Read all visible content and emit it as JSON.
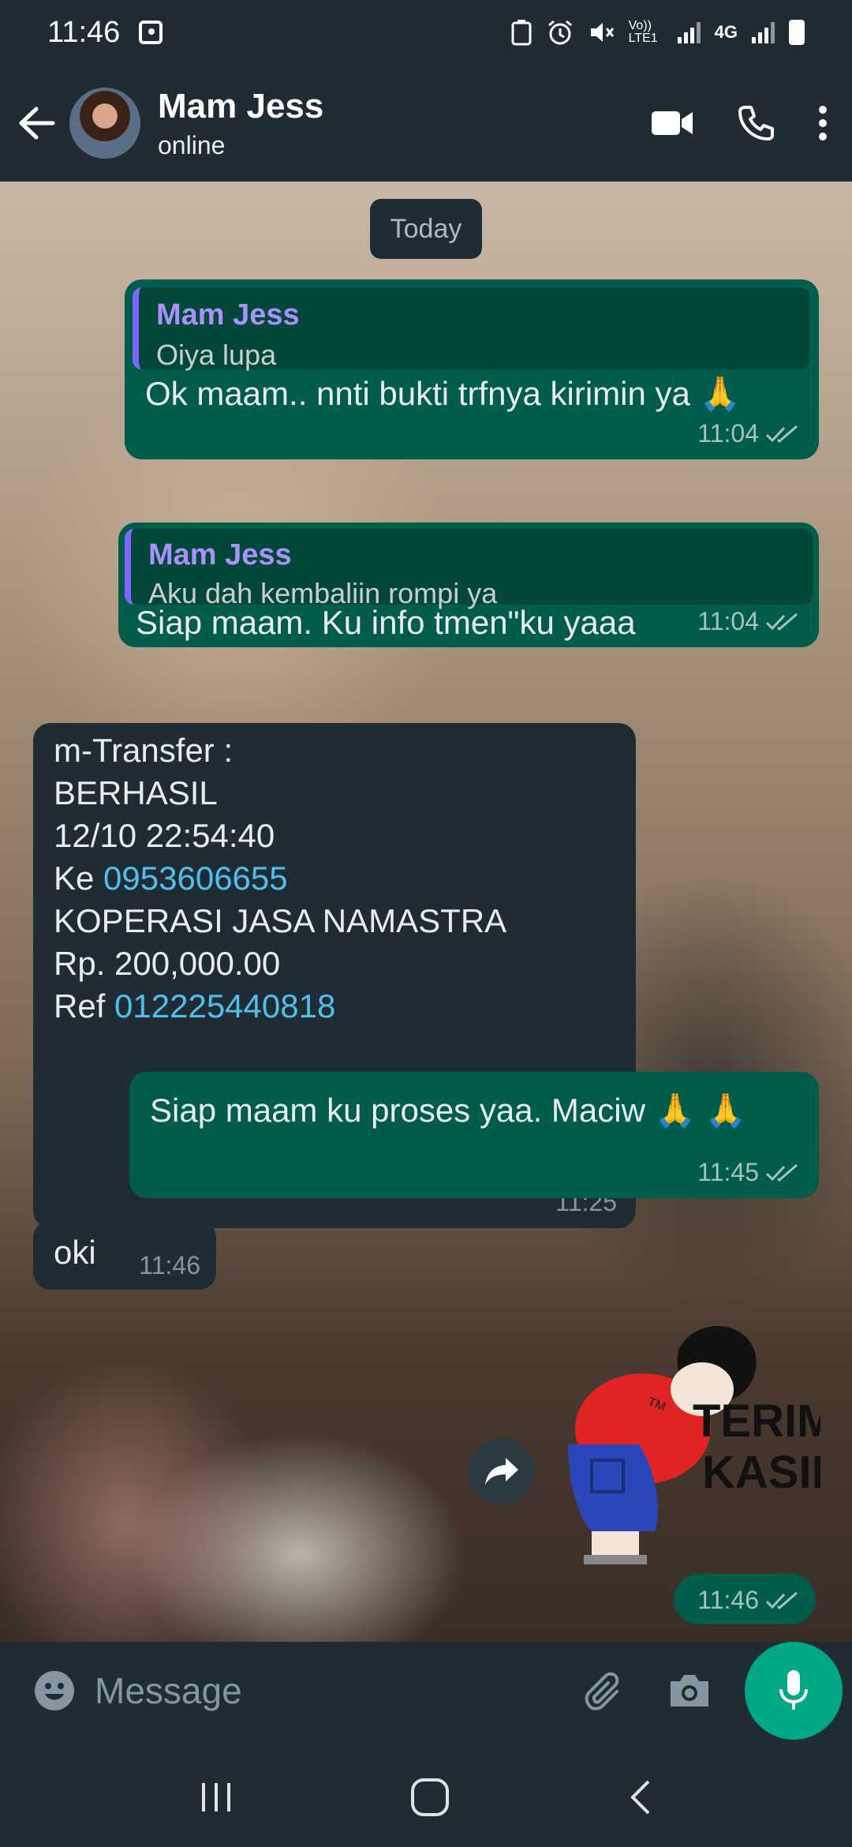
{
  "status_bar": {
    "time": "11:46",
    "network_1": "Vo)) LTE1",
    "network_2": "4G"
  },
  "header": {
    "contact_name": "Mam Jess",
    "contact_status": "online"
  },
  "chat": {
    "date_label": "Today",
    "messages": [
      {
        "quote_name": "Mam Jess",
        "quote_text": "Oiya lupa",
        "text": "Ok maam.. nnti bukti trfnya kirimin ya 🙏",
        "time": "11:04"
      },
      {
        "quote_name": "Mam Jess",
        "quote_text": "Aku dah kembaliin rompi ya",
        "text": "Siap maam. Ku info tmen\"ku yaaa",
        "time": "11:04"
      },
      {
        "lines": [
          "m-Transfer :",
          "BERHASIL",
          "12/10 22:54:40",
          "KOPERASI JASA NAMASTRA",
          "Rp. 200,000.00"
        ],
        "ke_label": "Ke",
        "ke_number": "0953606655",
        "ref_label": "Ref",
        "ref_number": "012225440818",
        "time": "11:25"
      },
      {
        "text": "Siap maam ku proses yaa. Maciw 🙏 🙏",
        "time": "11:45"
      },
      {
        "text": "oki",
        "time": "11:46"
      },
      {
        "sticker_text_1": "TERIMA",
        "sticker_text_2": "KASIH",
        "sticker_mark": "TM",
        "time": "11:46"
      }
    ]
  },
  "composer": {
    "placeholder": "Message"
  },
  "colors": {
    "header_bg": "#1f2c34",
    "outgoing_bubble": "#005c4b",
    "incoming_bubble": "#1f2c34",
    "accent": "#00a884",
    "link": "#53bdeb",
    "quote_bar": "#7f66ff"
  }
}
